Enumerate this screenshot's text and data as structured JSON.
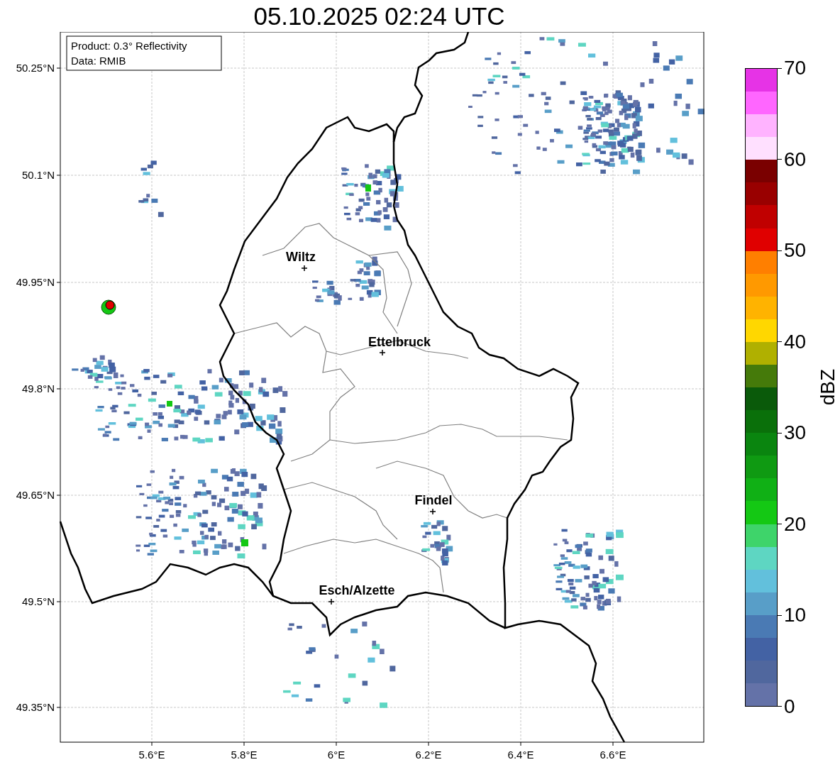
{
  "title": "05.10.2025 02:24 UTC",
  "map": {
    "info_box": [
      "Product: 0.3° Reflectivity",
      "Data: RMIB"
    ],
    "cities": [
      "Wiltz",
      "Ettelbruck",
      "Findel",
      "Esch/Alzette"
    ],
    "xticks": [
      "5.6°E",
      "5.8°E",
      "6°E",
      "6.2°E",
      "6.4°E",
      "6.6°E"
    ],
    "yticks": [
      "50.25°N",
      "50.1°N",
      "49.95°N",
      "49.8°N",
      "49.65°N",
      "49.5°N",
      "49.35°N"
    ]
  },
  "colorbar": {
    "label": "dBZ",
    "ticks": [
      "70",
      "60",
      "50",
      "40",
      "30",
      "20",
      "10",
      "0"
    ],
    "segments": [
      {
        "color": "#e633e6"
      },
      {
        "color": "#ff66ff"
      },
      {
        "color": "#ffb3ff"
      },
      {
        "color": "#ffe0ff"
      },
      {
        "color": "#7a0000"
      },
      {
        "color": "#990000"
      },
      {
        "color": "#c00000"
      },
      {
        "color": "#e00000"
      },
      {
        "color": "#ff7f00"
      },
      {
        "color": "#ff9900"
      },
      {
        "color": "#ffb300"
      },
      {
        "color": "#ffd700"
      },
      {
        "color": "#b0b000"
      },
      {
        "color": "#457a0a"
      },
      {
        "color": "#0a5a0a"
      },
      {
        "color": "#0a700a"
      },
      {
        "color": "#0a850f"
      },
      {
        "color": "#0f9a12"
      },
      {
        "color": "#10b015"
      },
      {
        "color": "#14c814"
      },
      {
        "color": "#3ed46a"
      },
      {
        "color": "#5ed6c2"
      },
      {
        "color": "#62c0dc"
      },
      {
        "color": "#589ec8"
      },
      {
        "color": "#4a7ab4"
      },
      {
        "color": "#4362a4"
      },
      {
        "color": "#50679e"
      },
      {
        "color": "#6472a8"
      }
    ]
  }
}
